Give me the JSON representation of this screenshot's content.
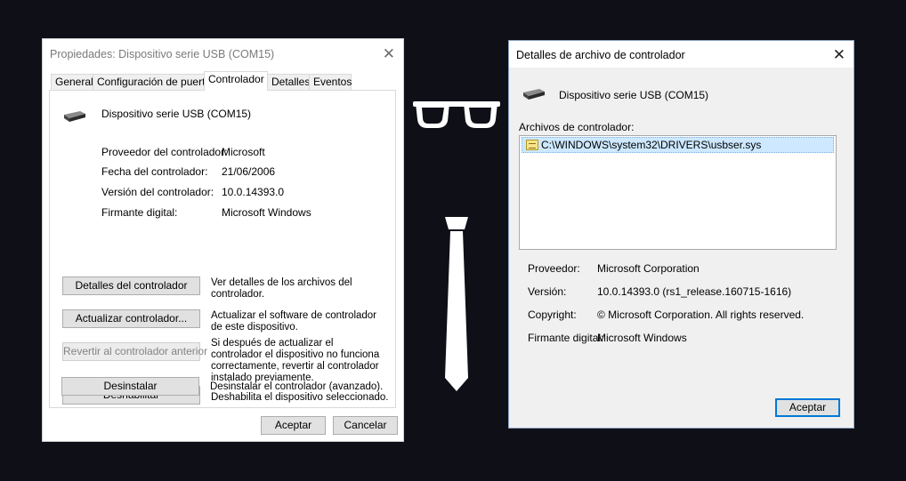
{
  "left_window": {
    "title": "Propiedades: Dispositivo serie USB (COM15)",
    "tabs": [
      "General",
      "Configuración de puerto",
      "Controlador",
      "Detalles",
      "Eventos"
    ],
    "active_tab": "Controlador",
    "device_name": "Dispositivo serie USB (COM15)",
    "properties": [
      {
        "label": "Proveedor del controlador:",
        "value": "Microsoft"
      },
      {
        "label": "Fecha del controlador:",
        "value": "21/06/2006"
      },
      {
        "label": "Versión del controlador:",
        "value": "10.0.14393.0"
      },
      {
        "label": "Firmante digital:",
        "value": "Microsoft Windows"
      }
    ],
    "actions": [
      {
        "button": "Detalles del controlador",
        "description": "Ver detalles de los archivos del controlador.",
        "disabled": false
      },
      {
        "button": "Actualizar controlador...",
        "description": "Actualizar el software de controlador de este dispositivo.",
        "disabled": false
      },
      {
        "button": "Revertir al controlador anterior",
        "description": "Si después de actualizar el controlador el dispositivo no funciona correctamente, revertir al controlador instalado previamente.",
        "disabled": true
      },
      {
        "button": "Deshabilitar",
        "description": "Deshabilita el dispositivo seleccionado.",
        "disabled": false
      },
      {
        "button": "Desinstalar",
        "description": "Desinstalar el controlador (avanzado).",
        "disabled": false
      }
    ],
    "ok_label": "Aceptar",
    "cancel_label": "Cancelar"
  },
  "right_window": {
    "title": "Detalles de archivo de controlador",
    "device_name": "Dispositivo serie USB (COM15)",
    "files_label": "Archivos de controlador:",
    "files": [
      "C:\\WINDOWS\\system32\\DRIVERS\\usbser.sys"
    ],
    "details": [
      {
        "label": "Proveedor:",
        "value": "Microsoft Corporation"
      },
      {
        "label": "Versión:",
        "value": "10.0.14393.0 (rs1_release.160715-1616)"
      },
      {
        "label": "Copyright:",
        "value": "© Microsoft Corporation. All rights reserved."
      },
      {
        "label": "Firmante digital:",
        "value": "Microsoft Windows"
      }
    ],
    "ok_label": "Aceptar"
  },
  "colors": {
    "background": "#0f0f17",
    "accent": "#0078d7",
    "selection": "#cde8ff"
  },
  "icons": {
    "close": "close-icon",
    "device": "usb-device-icon",
    "file": "driver-file-icon",
    "glasses": "glasses-icon",
    "tie": "tie-icon"
  }
}
